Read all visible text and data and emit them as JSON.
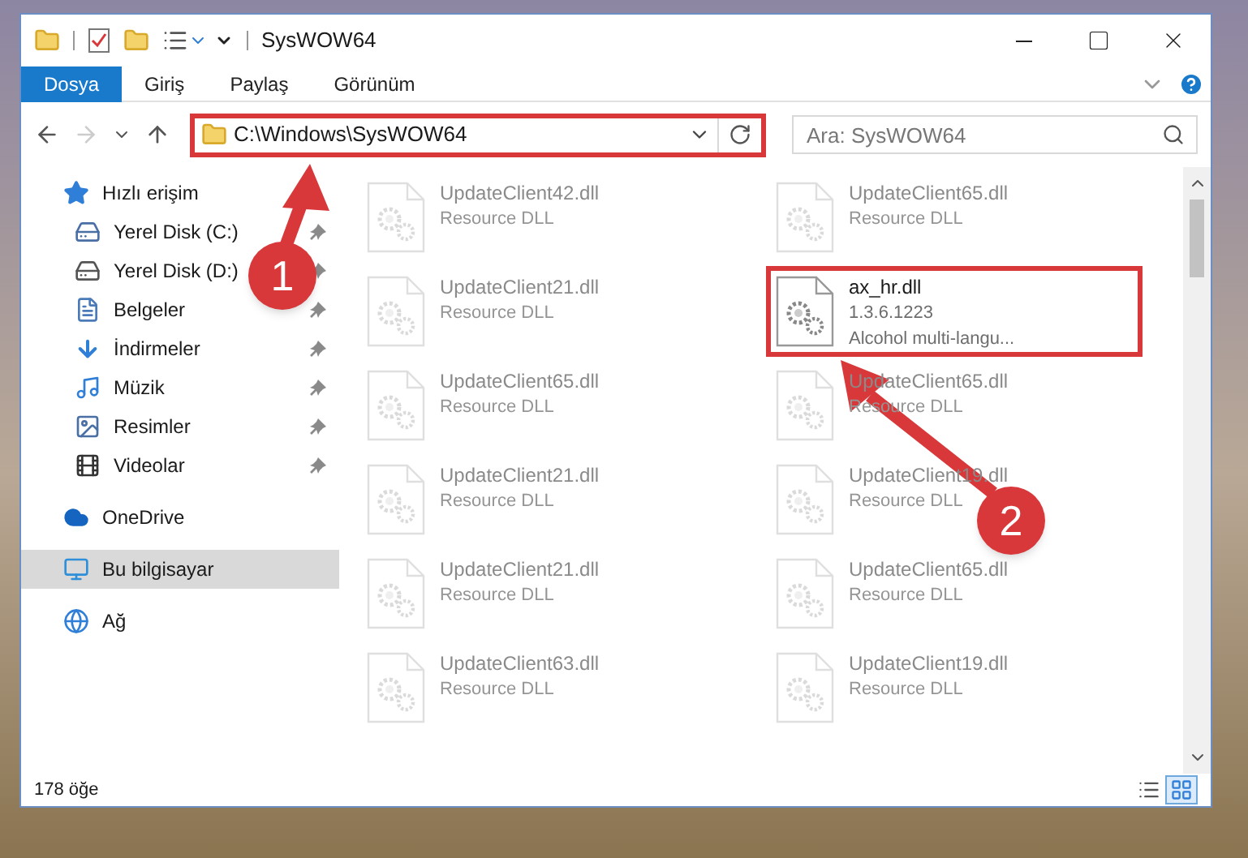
{
  "window": {
    "title": "SysWOW64"
  },
  "ribbon_tabs": [
    {
      "label": "Dosya",
      "selected": true
    },
    {
      "label": "Giriş",
      "selected": false
    },
    {
      "label": "Paylaş",
      "selected": false
    },
    {
      "label": "Görünüm",
      "selected": false
    }
  ],
  "navigation": {
    "back_disabled": false,
    "forward_disabled": true
  },
  "address_bar": {
    "path": "C:\\Windows\\SysWOW64",
    "highlighted": true
  },
  "search": {
    "placeholder": "Ara: SysWOW64"
  },
  "sidebar": {
    "items": [
      {
        "label": "Hızlı erişim",
        "kind": "star",
        "selected": false,
        "children": [
          {
            "label": "Yerel Disk (C:)",
            "kind": "system-drive",
            "pinned": true,
            "selected": false
          },
          {
            "label": "Yerel Disk (D:)",
            "kind": "drive",
            "pinned": true,
            "selected": false
          },
          {
            "label": "Belgeler",
            "kind": "documents",
            "pinned": true,
            "selected": false
          },
          {
            "label": "İndirmeler",
            "kind": "downloads",
            "pinned": true,
            "selected": false
          },
          {
            "label": "Müzik",
            "kind": "music",
            "pinned": true,
            "selected": false
          },
          {
            "label": "Resimler",
            "kind": "pictures",
            "pinned": true,
            "selected": false
          },
          {
            "label": "Videolar",
            "kind": "videos",
            "pinned": true,
            "selected": false
          }
        ]
      },
      {
        "label": "OneDrive",
        "kind": "cloud",
        "selected": false
      },
      {
        "label": "Bu bilgisayar",
        "kind": "computer",
        "selected": true
      },
      {
        "label": "Ağ",
        "kind": "network",
        "selected": false
      }
    ]
  },
  "files": [
    {
      "name": "UpdateClient42.dll",
      "details": [
        "Resource DLL"
      ],
      "dimmed": true,
      "highlighted": false
    },
    {
      "name": "UpdateClient65.dll",
      "details": [
        "Resource DLL"
      ],
      "dimmed": true,
      "highlighted": false
    },
    {
      "name": "UpdateClient21.dll",
      "details": [
        "Resource DLL"
      ],
      "dimmed": true,
      "highlighted": false
    },
    {
      "name": "ax_hr.dll",
      "details": [
        "1.3.6.1223",
        "Alcohol multi-langu..."
      ],
      "dimmed": false,
      "highlighted": true
    },
    {
      "name": "UpdateClient65.dll",
      "details": [
        "Resource DLL"
      ],
      "dimmed": true,
      "highlighted": false
    },
    {
      "name": "UpdateClient65.dll",
      "details": [
        "Resource DLL"
      ],
      "dimmed": true,
      "highlighted": false
    },
    {
      "name": "UpdateClient21.dll",
      "details": [
        "Resource DLL"
      ],
      "dimmed": true,
      "highlighted": false
    },
    {
      "name": "UpdateClient19.dll",
      "details": [
        "Resource DLL"
      ],
      "dimmed": true,
      "highlighted": false
    },
    {
      "name": "UpdateClient21.dll",
      "details": [
        "Resource DLL"
      ],
      "dimmed": true,
      "highlighted": false
    },
    {
      "name": "UpdateClient65.dll",
      "details": [
        "Resource DLL"
      ],
      "dimmed": true,
      "highlighted": false
    },
    {
      "name": "UpdateClient63.dll",
      "details": [
        "Resource DLL"
      ],
      "dimmed": true,
      "highlighted": false
    },
    {
      "name": "UpdateClient19.dll",
      "details": [
        "Resource DLL"
      ],
      "dimmed": true,
      "highlighted": false
    }
  ],
  "status_bar": {
    "count": "178 öğe",
    "views": [
      {
        "kind": "details",
        "selected": false
      },
      {
        "kind": "large-icons",
        "selected": true
      }
    ]
  },
  "markers": [
    {
      "label": "1"
    },
    {
      "label": "2"
    }
  ]
}
